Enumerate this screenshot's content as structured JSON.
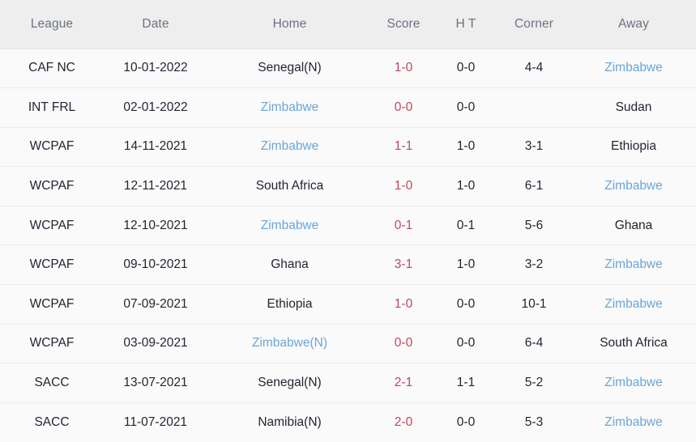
{
  "table": {
    "columns": [
      {
        "key": "league",
        "label": "League"
      },
      {
        "key": "date",
        "label": "Date"
      },
      {
        "key": "home",
        "label": "Home"
      },
      {
        "key": "score",
        "label": "Score"
      },
      {
        "key": "ht",
        "label": "H T"
      },
      {
        "key": "corner",
        "label": "Corner"
      },
      {
        "key": "away",
        "label": "Away"
      }
    ],
    "colors": {
      "header_background": "#eeeeee",
      "header_text": "#6b7280",
      "row_background": "#fafafa",
      "row_border": "#ececec",
      "text": "#1f2430",
      "score_red": "#c0485a",
      "team_link_blue": "#6aa6d8"
    },
    "rows": [
      {
        "league": "CAF NC",
        "date": "10-01-2022",
        "home": "Senegal(N)",
        "home_style": "default",
        "score": "1-0",
        "ht": "0-0",
        "corner": "4-4",
        "away": "Zimbabwe",
        "away_style": "link"
      },
      {
        "league": "INT FRL",
        "date": "02-01-2022",
        "home": "Zimbabwe",
        "home_style": "link",
        "score": "0-0",
        "ht": "0-0",
        "corner": "",
        "away": "Sudan",
        "away_style": "default"
      },
      {
        "league": "WCPAF",
        "date": "14-11-2021",
        "home": "Zimbabwe",
        "home_style": "link",
        "score": "1-1",
        "ht": "1-0",
        "corner": "3-1",
        "away": "Ethiopia",
        "away_style": "default"
      },
      {
        "league": "WCPAF",
        "date": "12-11-2021",
        "home": "South Africa",
        "home_style": "default",
        "score": "1-0",
        "ht": "1-0",
        "corner": "6-1",
        "away": "Zimbabwe",
        "away_style": "link"
      },
      {
        "league": "WCPAF",
        "date": "12-10-2021",
        "home": "Zimbabwe",
        "home_style": "link",
        "score": "0-1",
        "ht": "0-1",
        "corner": "5-6",
        "away": "Ghana",
        "away_style": "default"
      },
      {
        "league": "WCPAF",
        "date": "09-10-2021",
        "home": "Ghana",
        "home_style": "default",
        "score": "3-1",
        "ht": "1-0",
        "corner": "3-2",
        "away": "Zimbabwe",
        "away_style": "link"
      },
      {
        "league": "WCPAF",
        "date": "07-09-2021",
        "home": "Ethiopia",
        "home_style": "default",
        "score": "1-0",
        "ht": "0-0",
        "corner": "10-1",
        "away": "Zimbabwe",
        "away_style": "link"
      },
      {
        "league": "WCPAF",
        "date": "03-09-2021",
        "home": "Zimbabwe(N)",
        "home_style": "link",
        "score": "0-0",
        "ht": "0-0",
        "corner": "6-4",
        "away": "South Africa",
        "away_style": "default"
      },
      {
        "league": "SACC",
        "date": "13-07-2021",
        "home": "Senegal(N)",
        "home_style": "default",
        "score": "2-1",
        "ht": "1-1",
        "corner": "5-2",
        "away": "Zimbabwe",
        "away_style": "link"
      },
      {
        "league": "SACC",
        "date": "11-07-2021",
        "home": "Namibia(N)",
        "home_style": "default",
        "score": "2-0",
        "ht": "0-0",
        "corner": "5-3",
        "away": "Zimbabwe",
        "away_style": "link"
      }
    ]
  }
}
